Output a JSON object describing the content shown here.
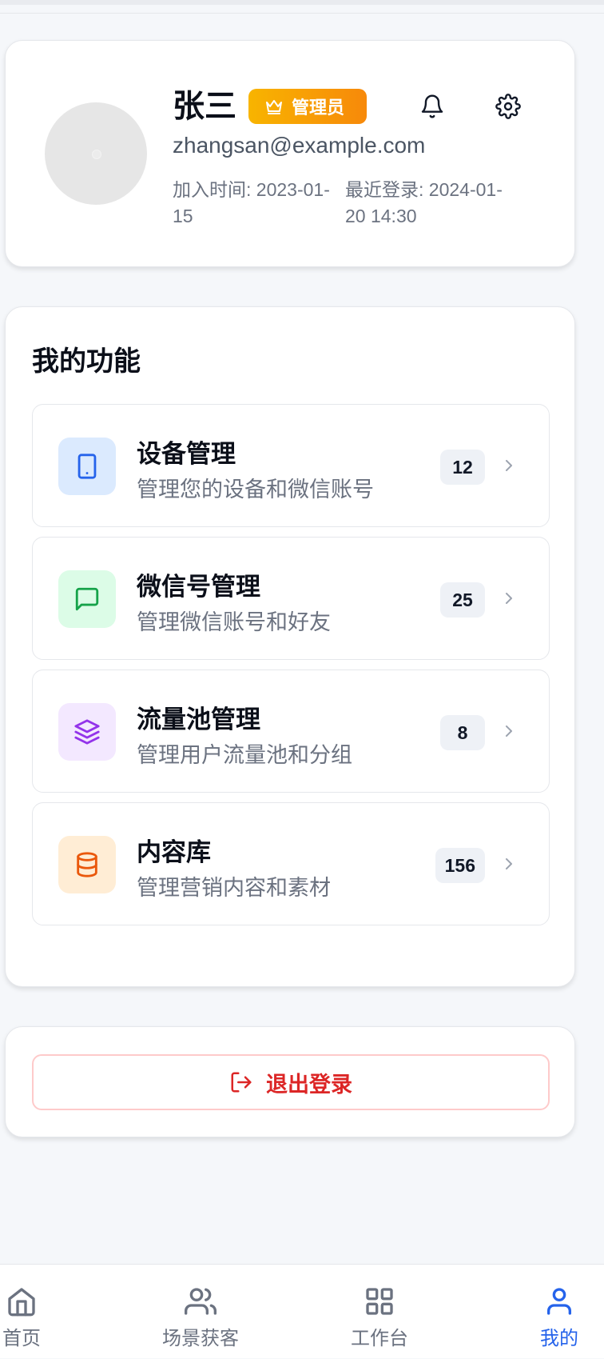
{
  "profile": {
    "name": "张三",
    "badge": "管理员",
    "email": "zhangsan@example.com",
    "join_time": "加入时间: 2023-01-15",
    "last_login": "最近登录: 2024-01-20 14:30"
  },
  "features": {
    "title": "我的功能",
    "items": [
      {
        "title": "设备管理",
        "desc": "管理您的设备和微信账号",
        "count": "12",
        "icon": "tablet-icon",
        "color": "#2563eb",
        "bg": "#dbeafe"
      },
      {
        "title": "微信号管理",
        "desc": "管理微信账号和好友",
        "count": "25",
        "icon": "message-square-icon",
        "color": "#16a34a",
        "bg": "#dcfce7"
      },
      {
        "title": "流量池管理",
        "desc": "管理用户流量池和分组",
        "count": "8",
        "icon": "layers-icon",
        "color": "#9333ea",
        "bg": "#f3e8ff"
      },
      {
        "title": "内容库",
        "desc": "管理营销内容和素材",
        "count": "156",
        "icon": "database-icon",
        "color": "#ea580c",
        "bg": "#ffedd5"
      }
    ]
  },
  "logout": {
    "label": "退出登录",
    "color": "#dc2626"
  },
  "nav": {
    "tabs": [
      {
        "label": "首页",
        "icon": "home-icon"
      },
      {
        "label": "场景获客",
        "icon": "users-icon"
      },
      {
        "label": "工作台",
        "icon": "grid-icon"
      },
      {
        "label": "我的",
        "icon": "user-icon",
        "active": true
      }
    ],
    "active_color": "#2563eb",
    "inactive_color": "#6b7280"
  }
}
